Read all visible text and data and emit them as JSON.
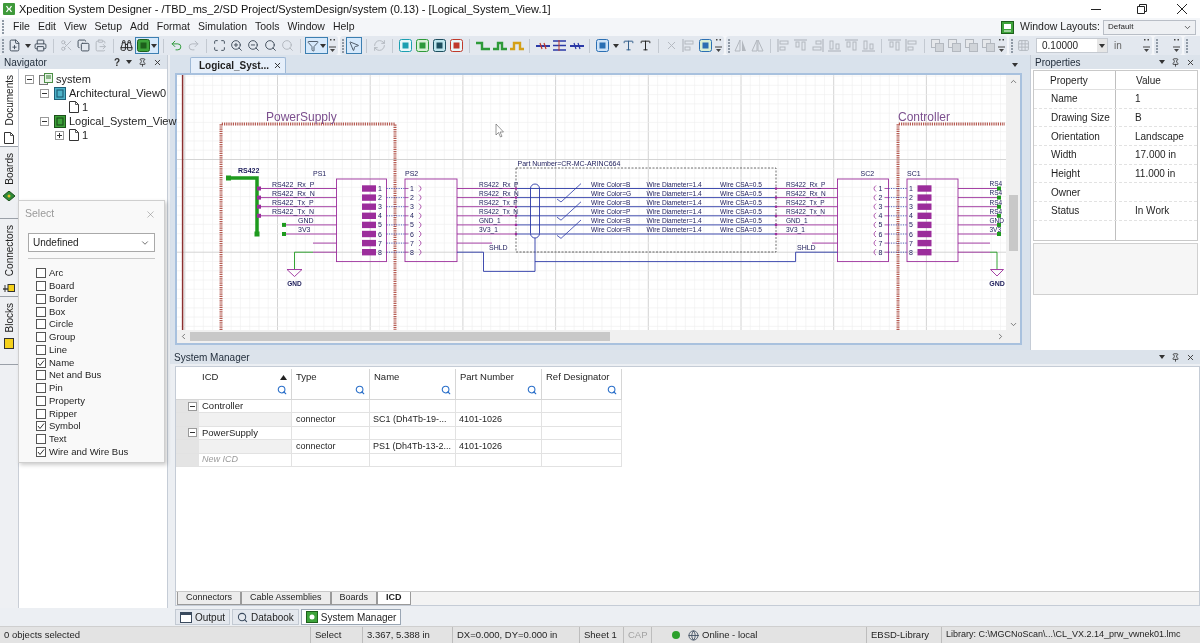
{
  "title_bar": {
    "title": "Xpedition System Designer - /TBD_ms_2/SD Project/SystemDesign/system (0.13) - [Logical_System_View.1]"
  },
  "menu": [
    "File",
    "Edit",
    "View",
    "Setup",
    "Add",
    "Format",
    "Simulation",
    "Tools",
    "Window",
    "Help"
  ],
  "window_layouts": {
    "label": "Window Layouts:",
    "value": "Default"
  },
  "toolbar": {
    "toggles": [
      {
        "pressed": true
      },
      {
        "pressed": true
      },
      {
        "pressed": true
      }
    ],
    "grid_value": "0.10000",
    "unit": "in"
  },
  "navigator": {
    "title": "Navigator",
    "help": "?",
    "side_tabs": [
      {
        "label": "Documents",
        "selected": true
      },
      {
        "label": "Boards",
        "selected": false
      },
      {
        "label": "Connectors",
        "selected": false
      },
      {
        "label": "Blocks",
        "selected": false
      }
    ],
    "tree": [
      {
        "label": "system",
        "kind": "system",
        "expanded": true,
        "children": [
          {
            "label": "Architectural_View0",
            "kind": "architecture",
            "expanded": true,
            "children": [
              {
                "label": "1",
                "kind": "sheet"
              }
            ]
          },
          {
            "label": "Logical_System_View",
            "kind": "logic",
            "expanded": true,
            "children": [
              {
                "label": "1",
                "kind": "sheet",
                "expanded": false
              }
            ]
          }
        ]
      }
    ]
  },
  "select_panel": {
    "title": "Select",
    "mode": "Undefined",
    "items": [
      {
        "label": "Arc",
        "checked": false
      },
      {
        "label": "Board",
        "checked": false
      },
      {
        "label": "Border",
        "checked": false
      },
      {
        "label": "Box",
        "checked": false
      },
      {
        "label": "Circle",
        "checked": false
      },
      {
        "label": "Group",
        "checked": false
      },
      {
        "label": "Line",
        "checked": false
      },
      {
        "label": "Name",
        "checked": true
      },
      {
        "label": "Net and Bus",
        "checked": false
      },
      {
        "label": "Pin",
        "checked": false
      },
      {
        "label": "Property",
        "checked": false
      },
      {
        "label": "Ripper",
        "checked": false
      },
      {
        "label": "Symbol",
        "checked": true
      },
      {
        "label": "Text",
        "checked": false
      },
      {
        "label": "Wire and Wire Bus",
        "checked": true
      }
    ]
  },
  "document_tabs": [
    {
      "label": "Logical_Syst...",
      "selected": true
    }
  ],
  "schematic": {
    "frames": [
      {
        "title": "PowerSupply"
      },
      {
        "title": "Controller"
      }
    ],
    "block": {
      "label": "RS422"
    },
    "left_signals": [
      "RS422_Rx_P",
      "RS422_Rx_N",
      "RS422_Tx_P",
      "RS422_Tx_N",
      "GND",
      "3V3"
    ],
    "connectors": [
      {
        "ref": "PS1",
        "kind": "plug",
        "pins": [
          "1",
          "2",
          "3",
          "4",
          "5",
          "6",
          "7",
          "8"
        ]
      },
      {
        "ref": "PS2",
        "kind": "socket",
        "pins": [
          "1",
          "2",
          "3",
          "4",
          "5",
          "6",
          "7",
          "8"
        ]
      },
      {
        "ref": "SC2",
        "kind": "socket",
        "pins": [
          "1",
          "2",
          "3",
          "4",
          "5",
          "6",
          "7",
          "8"
        ]
      },
      {
        "ref": "SC1",
        "kind": "plug",
        "pins": [
          "1",
          "2",
          "3",
          "4",
          "5",
          "6",
          "7",
          "8"
        ]
      }
    ],
    "cable": {
      "part_number": "Part Number=CR-MC-ARINC664",
      "left_nets": [
        "RS422_Rx_P",
        "RS422_Rx_N",
        "RS422_Tx_P",
        "RS422_Tx_N",
        "GND_1",
        "3V3_1"
      ],
      "wires": [
        {
          "color_text": "Wire Color=B",
          "diameter": "Wire Diameter=1.4",
          "csa": "Wire CSA=0.5"
        },
        {
          "color_text": "Wire Color=G",
          "diameter": "Wire Diameter=1.4",
          "csa": "Wire CSA=0.5"
        },
        {
          "color_text": "Wire Color=B",
          "diameter": "Wire Diameter=1.4",
          "csa": "Wire CSA=0.5"
        },
        {
          "color_text": "Wire Color=P",
          "diameter": "Wire Diameter=1.4",
          "csa": "Wire CSA=0.5"
        },
        {
          "color_text": "Wire Color=B",
          "diameter": "Wire Diameter=1.4",
          "csa": "Wire CSA=0.5"
        },
        {
          "color_text": "Wire Color=R",
          "diameter": "Wire Diameter=1.4",
          "csa": "Wire CSA=0.5"
        }
      ],
      "right_nets": [
        "RS422_Rx_P",
        "RS422_Rx_N",
        "RS422_Tx_P",
        "RS422_Tx_N",
        "GND_1",
        "3V3_1"
      ],
      "shield_labels": [
        "SHLD",
        "SHLD"
      ]
    },
    "right_signals": [
      "RS4",
      "RS4",
      "RS4",
      "RS4",
      "GND",
      "3V3"
    ],
    "ground_labels": [
      "GND",
      "GND"
    ]
  },
  "properties": {
    "title": "Properties",
    "columns": [
      "Property",
      "Value"
    ],
    "rows": [
      {
        "property": "Name",
        "value": "1"
      },
      {
        "property": "Drawing Size",
        "value": "B"
      },
      {
        "property": "Orientation",
        "value": "Landscape"
      },
      {
        "property": "Width",
        "value": "17.000 in"
      },
      {
        "property": "Height",
        "value": "11.000 in"
      },
      {
        "property": "Owner"
      },
      {
        "property": "Status",
        "value": "In Work"
      }
    ]
  },
  "system_manager": {
    "title": "System Manager",
    "columns": [
      {
        "label": "ICD",
        "sorted": true
      },
      {
        "label": "Type",
        "sorted": false
      },
      {
        "label": "Name",
        "sorted": false
      },
      {
        "label": "Part Number",
        "sorted": false
      },
      {
        "label": "Ref Designator",
        "sorted": false
      }
    ],
    "groups": [
      {
        "label": "Controller",
        "expanded": true,
        "rows": [
          {
            "type": "connector",
            "name": "SC1 (Dh4Tb-19-...",
            "part_number": "4101-1026"
          }
        ]
      },
      {
        "label": "PowerSupply",
        "expanded": true,
        "rows": [
          {
            "type": "connector",
            "name": "PS1 (Dh4Tb-13-2...",
            "part_number": "4101-1026"
          }
        ]
      }
    ],
    "new_row": {
      "placeholder": "New ICD"
    },
    "sheet_tabs": [
      {
        "label": "Connectors",
        "selected": false
      },
      {
        "label": "Cable Assemblies",
        "selected": false
      },
      {
        "label": "Boards",
        "selected": false
      },
      {
        "label": "ICD",
        "selected": true
      }
    ]
  },
  "panel_tabs": [
    {
      "label": "Output",
      "selected": false
    },
    {
      "label": "Databook",
      "selected": false
    },
    {
      "label": "System Manager",
      "selected": true
    }
  ],
  "status_bar": {
    "selection": "0 objects selected",
    "mode": "Select",
    "cursor": "3.367, 5.388 in",
    "offset": "DX=0.000, DY=0.000 in",
    "sheet": "Sheet 1",
    "caps": {
      "label": "CAP",
      "on": false
    },
    "connection": {
      "label": "Online - local",
      "online": true
    },
    "library": "EBSD-Library",
    "library_path": "Library: C:\\MGCNoScan\\...\\CL_VX.2.14_prw_vwnek01.lmc"
  }
}
